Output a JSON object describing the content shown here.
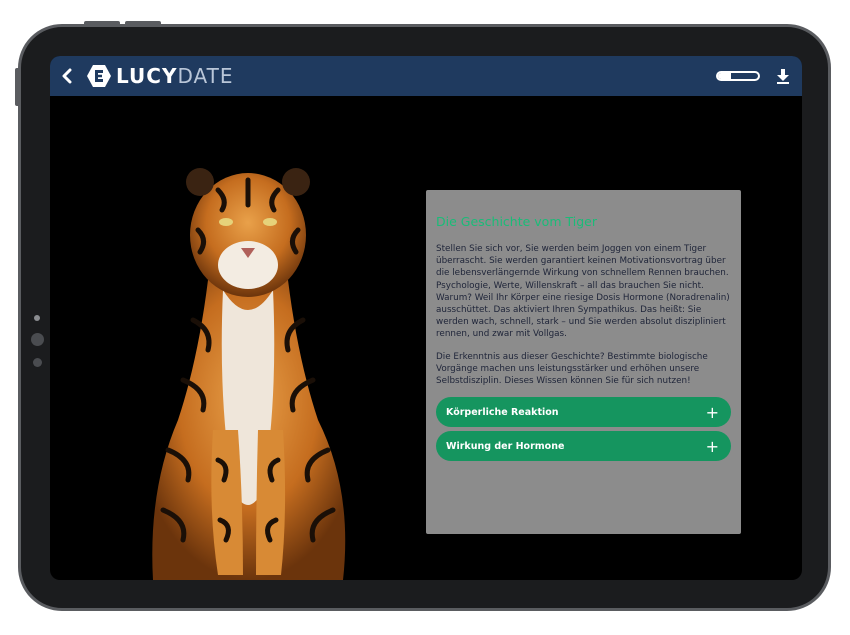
{
  "app": {
    "back_glyph": "‹",
    "logo_brand": "LUCY",
    "logo_suffix": "DATE",
    "progress_fraction": 0.32
  },
  "card": {
    "title": "Die Geschichte vom Tiger",
    "paragraph1": "Stellen Sie sich vor, Sie werden beim Joggen von einem Tiger überrascht. Sie werden garantiert keinen Motivationsvortrag über die lebensverlängernde Wirkung von schnellem Rennen brauchen. Psychologie, Werte, Willenskraft – all das brauchen Sie nicht. Warum? Weil Ihr Körper eine riesige Dosis Hormone (Noradrenalin) ausschüttet. Das aktiviert Ihren Sympathikus. Das heißt: Sie werden wach, schnell, stark – und Sie werden absolut diszipliniert rennen, und zwar mit Vollgas.",
    "paragraph2": "Die Erkenntnis aus dieser Geschichte? Bestimmte biologische Vorgänge machen uns leistungsstärker und erhöhen unsere Selbstdisziplin. Dieses Wissen können Sie für sich nutzen!",
    "accordions": [
      {
        "label": "Körperliche Reaktion",
        "icon": "+"
      },
      {
        "label": "Wirkung der Hormone",
        "icon": "+"
      }
    ]
  },
  "colors": {
    "header": "#1f3a5f",
    "accent_green": "#15955f",
    "title_green": "#1abc78",
    "card_bg": "#8c8c8c"
  },
  "icons": [
    "back-chevron-icon",
    "lucydate-logo-icon",
    "progress-bar",
    "download-icon",
    "plus-icon",
    "tiger-image"
  ]
}
